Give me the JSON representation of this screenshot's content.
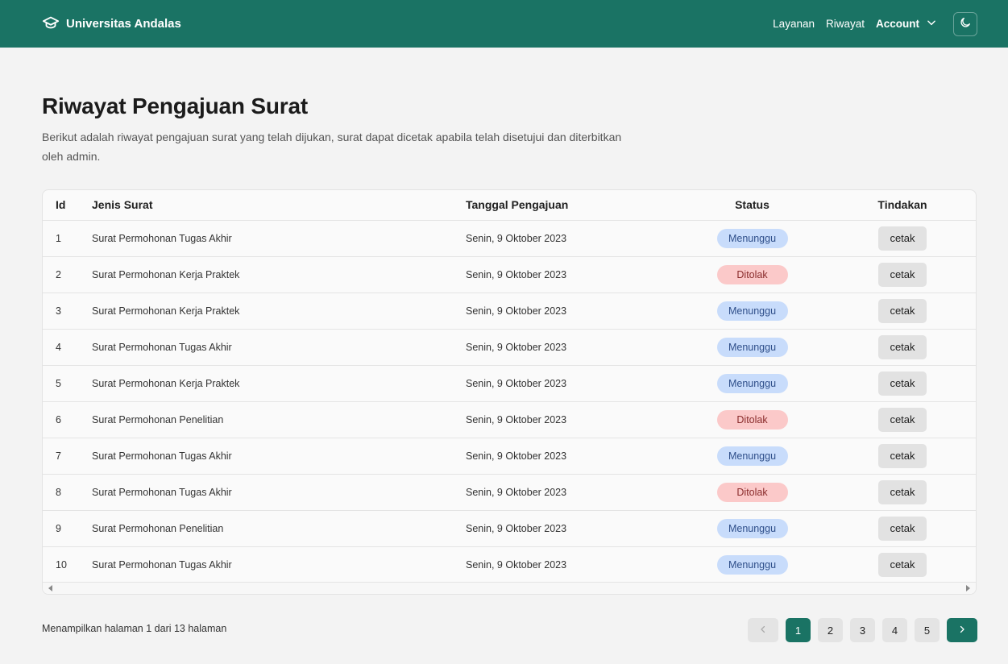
{
  "navbar": {
    "brand": "Universitas Andalas",
    "links": [
      "Layanan",
      "Riwayat"
    ],
    "account_label": "Account"
  },
  "page": {
    "title": "Riwayat Pengajuan Surat",
    "description": "Berikut adalah riwayat pengajuan surat yang telah dijukan, surat dapat dicetak apabila telah disetujui dan diterbitkan oleh admin."
  },
  "table": {
    "headers": [
      "Id",
      "Jenis Surat",
      "Tanggal Pengajuan",
      "Status",
      "Tindakan"
    ],
    "rows": [
      {
        "id": "1",
        "jenis": "Surat Permohonan Tugas Akhir",
        "tanggal": "Senin, 9 Oktober 2023",
        "status": "Menunggu",
        "status_type": "wait",
        "aksi": "cetak"
      },
      {
        "id": "2",
        "jenis": "Surat Permohonan Kerja Praktek",
        "tanggal": "Senin, 9 Oktober 2023",
        "status": "Ditolak",
        "status_type": "reject",
        "aksi": "cetak"
      },
      {
        "id": "3",
        "jenis": "Surat Permohonan Kerja Praktek",
        "tanggal": "Senin, 9 Oktober 2023",
        "status": "Menunggu",
        "status_type": "wait",
        "aksi": "cetak"
      },
      {
        "id": "4",
        "jenis": "Surat Permohonan Tugas Akhir",
        "tanggal": "Senin, 9 Oktober 2023",
        "status": "Menunggu",
        "status_type": "wait",
        "aksi": "cetak"
      },
      {
        "id": "5",
        "jenis": "Surat Permohonan Kerja Praktek",
        "tanggal": "Senin, 9 Oktober 2023",
        "status": "Menunggu",
        "status_type": "wait",
        "aksi": "cetak"
      },
      {
        "id": "6",
        "jenis": "Surat Permohonan Penelitian",
        "tanggal": "Senin, 9 Oktober 2023",
        "status": "Ditolak",
        "status_type": "reject",
        "aksi": "cetak"
      },
      {
        "id": "7",
        "jenis": "Surat Permohonan Tugas Akhir",
        "tanggal": "Senin, 9 Oktober 2023",
        "status": "Menunggu",
        "status_type": "wait",
        "aksi": "cetak"
      },
      {
        "id": "8",
        "jenis": "Surat Permohonan Tugas Akhir",
        "tanggal": "Senin, 9 Oktober 2023",
        "status": "Ditolak",
        "status_type": "reject",
        "aksi": "cetak"
      },
      {
        "id": "9",
        "jenis": "Surat Permohonan Penelitian",
        "tanggal": "Senin, 9 Oktober 2023",
        "status": "Menunggu",
        "status_type": "wait",
        "aksi": "cetak"
      },
      {
        "id": "10",
        "jenis": "Surat Permohonan Tugas Akhir",
        "tanggal": "Senin, 9 Oktober 2023",
        "status": "Menunggu",
        "status_type": "wait",
        "aksi": "cetak"
      }
    ]
  },
  "pagination": {
    "info": "Menampilkan halaman 1 dari 13 halaman",
    "pages": [
      "1",
      "2",
      "3",
      "4",
      "5"
    ],
    "current": "1"
  },
  "icons": {
    "brand": "graduation-cap-icon",
    "account_dropdown": "chevron-down-icon",
    "theme": "moon-icon",
    "prev": "chevron-left-icon",
    "next": "chevron-right-icon"
  },
  "colors": {
    "primary": "#1a7364",
    "badge_wait_bg": "#c8dcfb",
    "badge_reject_bg": "#fbc9c9",
    "background": "#f3f3f3"
  }
}
